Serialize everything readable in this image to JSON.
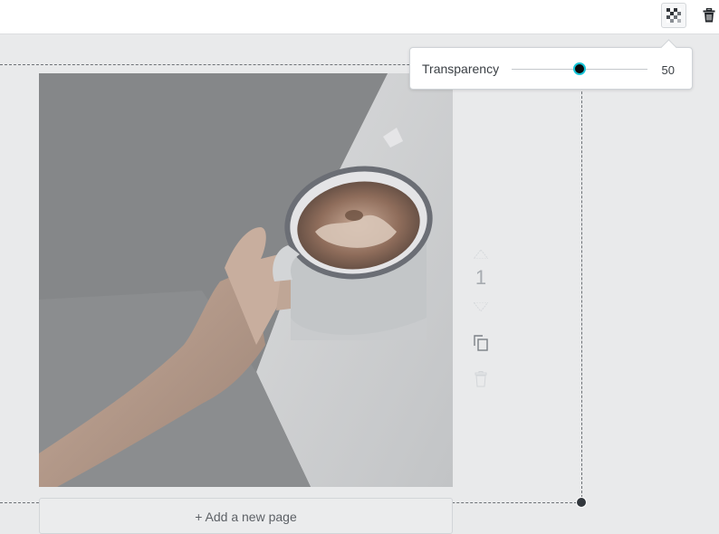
{
  "toolbar": {
    "transparency_button_icon": "checkerboard-icon",
    "delete_button_icon": "trash-icon"
  },
  "transparency_popover": {
    "label": "Transparency",
    "value": "50",
    "value_fraction": 0.5,
    "accent_color": "#18c5d8"
  },
  "page_controls": {
    "page_number": "1",
    "move_up_icon": "triangle-up-icon",
    "move_down_icon": "triangle-down-icon",
    "duplicate_icon": "copy-icon",
    "delete_icon": "trash-icon"
  },
  "add_page": {
    "label": "+ Add a new page"
  },
  "photo": {
    "subject": "hand-holding-coffee-mug-photo"
  }
}
